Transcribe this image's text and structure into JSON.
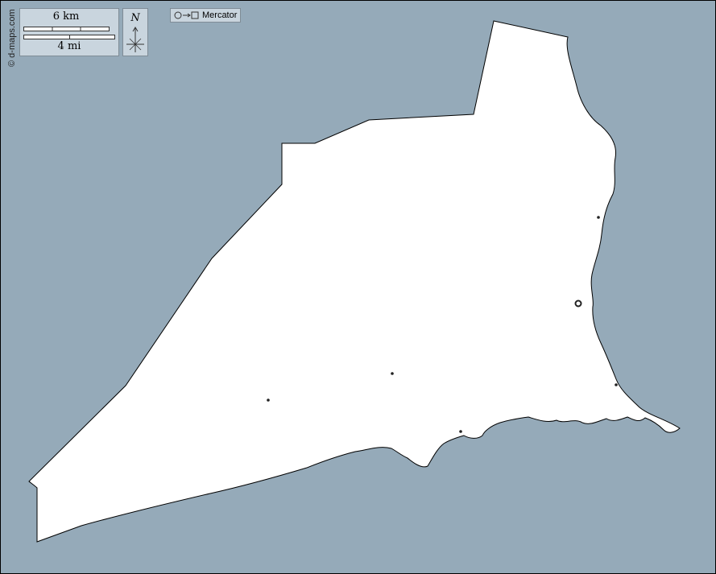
{
  "map": {
    "credit": "© d-maps.com",
    "projection": {
      "label": "Mercator",
      "icon": "circle-to-square-icon"
    },
    "scale": {
      "km_label": "6 km",
      "mi_label": "4 mi"
    },
    "north_arrow": {
      "label": "N",
      "icon": "compass-rose-icon"
    },
    "colors": {
      "water": "#95aab9",
      "land": "#ffffff",
      "border": "#000000",
      "legend_fill": "#c9d5de"
    },
    "markers": [
      {
        "type": "capital",
        "icon": "capital-circle-icon"
      },
      {
        "type": "town",
        "icon": "town-dot-icon"
      },
      {
        "type": "town",
        "icon": "town-dot-icon"
      },
      {
        "type": "town",
        "icon": "town-dot-icon"
      },
      {
        "type": "town",
        "icon": "town-dot-icon"
      },
      {
        "type": "town",
        "icon": "town-dot-icon"
      }
    ]
  }
}
